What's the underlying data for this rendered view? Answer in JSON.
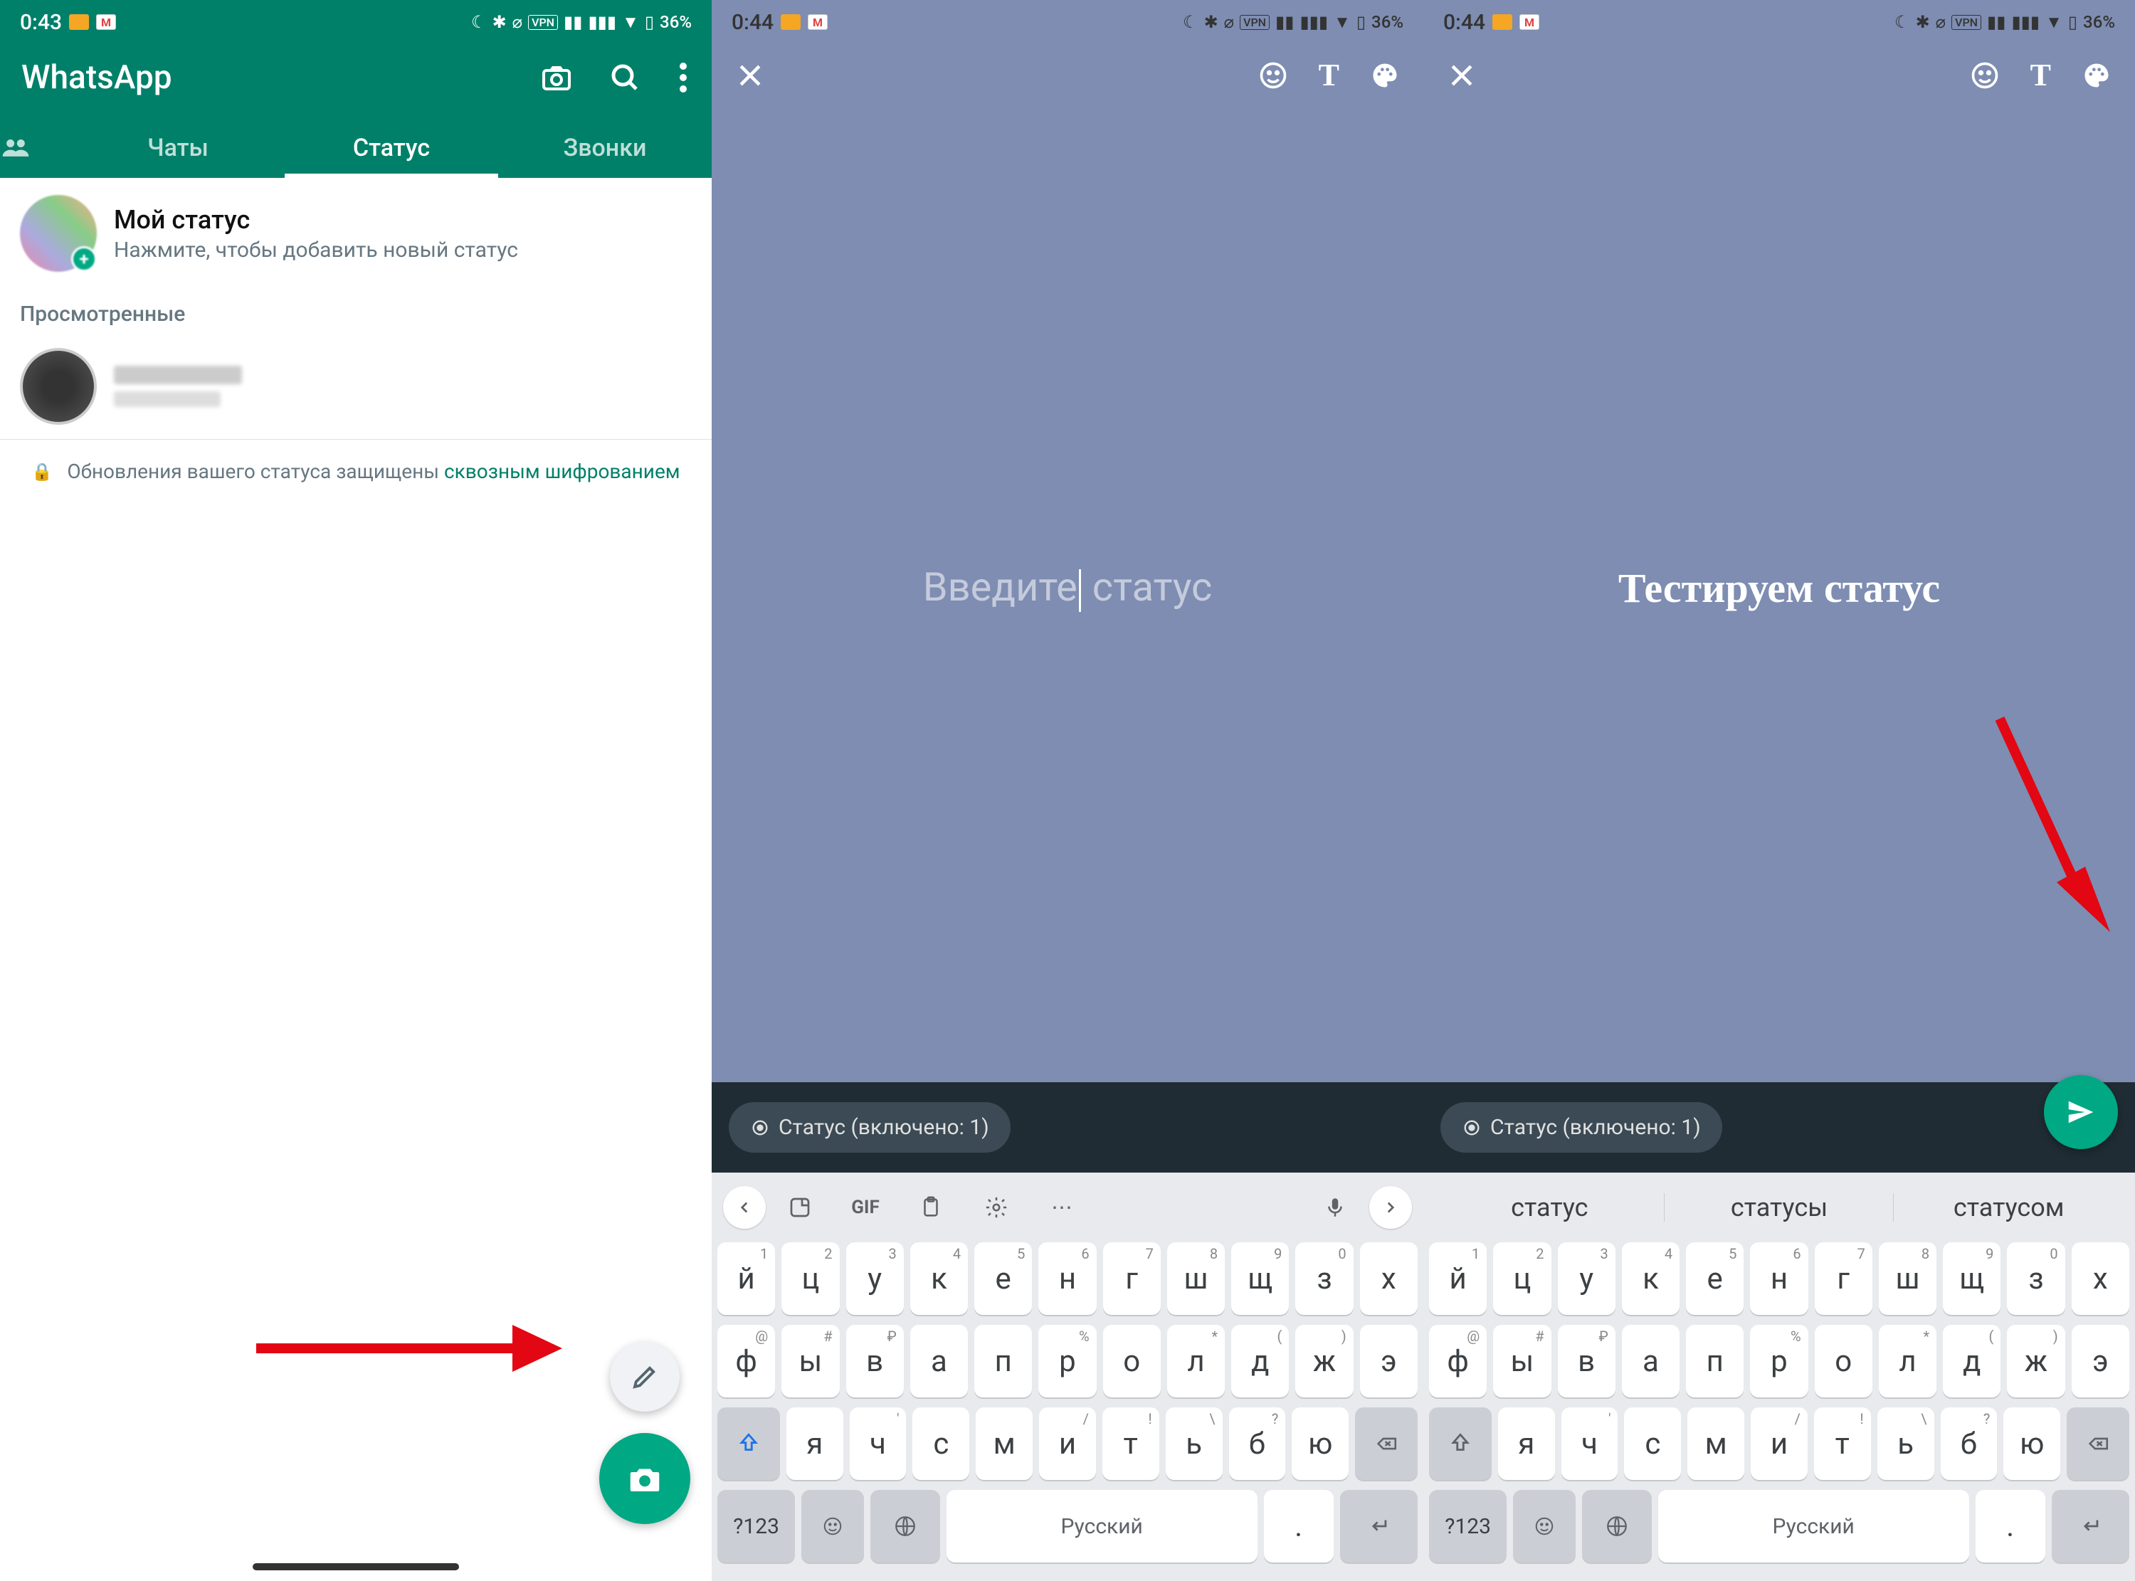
{
  "s1": {
    "time": "0:43",
    "battery": "36%",
    "appTitle": "WhatsApp",
    "tabs": {
      "chats": "Чаты",
      "status": "Статус",
      "calls": "Звонки"
    },
    "myStatus": {
      "title": "Мой статус",
      "sub": "Нажмите, чтобы добавить новый статус"
    },
    "sectionViewed": "Просмотренные",
    "encryption": {
      "prefix": "Обновления вашего статуса защищены ",
      "link": "сквозным шифрованием"
    }
  },
  "s2": {
    "time": "0:44",
    "battery": "36%",
    "placeholder": "Введите статус",
    "chip": "Статус (включено: 1)",
    "kb": {
      "row1": [
        "й",
        "ц",
        "у",
        "к",
        "е",
        "н",
        "г",
        "ш",
        "щ",
        "з",
        "х"
      ],
      "sup1": [
        "1",
        "2",
        "3",
        "4",
        "5",
        "6",
        "7",
        "8",
        "9",
        "0",
        ""
      ],
      "row2": [
        "ф",
        "ы",
        "в",
        "а",
        "п",
        "р",
        "о",
        "л",
        "д",
        "ж",
        "э"
      ],
      "sup2": [
        "@",
        "#",
        "₽",
        "",
        "",
        "%",
        "",
        "*",
        "(",
        ")",
        ""
      ],
      "row3": [
        "я",
        "ч",
        "с",
        "м",
        "и",
        "т",
        "ь",
        "б",
        "ю"
      ],
      "sup3": [
        "",
        "'",
        "",
        "",
        "/",
        "!",
        "\\",
        "?",
        ""
      ],
      "numKey": "?123",
      "space": "Русский"
    }
  },
  "s3": {
    "time": "0:44",
    "battery": "36%",
    "typed": "Тестируем статус",
    "chip": "Статус (включено: 1)",
    "suggestions": [
      "статус",
      "статусы",
      "статусом"
    ],
    "kb": {
      "row1": [
        "й",
        "ц",
        "у",
        "к",
        "е",
        "н",
        "г",
        "ш",
        "щ",
        "з",
        "х"
      ],
      "sup1": [
        "1",
        "2",
        "3",
        "4",
        "5",
        "6",
        "7",
        "8",
        "9",
        "0",
        ""
      ],
      "row2": [
        "ф",
        "ы",
        "в",
        "а",
        "п",
        "р",
        "о",
        "л",
        "д",
        "ж",
        "э"
      ],
      "sup2": [
        "@",
        "#",
        "₽",
        "",
        "",
        "%",
        "",
        "*",
        "(",
        ")",
        ""
      ],
      "row3": [
        "я",
        "ч",
        "с",
        "м",
        "и",
        "т",
        "ь",
        "б",
        "ю"
      ],
      "sup3": [
        "",
        "'",
        "",
        "",
        "/",
        "!",
        "\\",
        "?",
        ""
      ],
      "numKey": "?123",
      "space": "Русский"
    }
  }
}
